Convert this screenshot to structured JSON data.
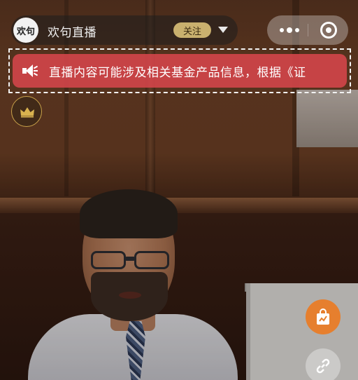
{
  "host": {
    "avatar_text": "欢句",
    "name": "欢句直播",
    "follow_label": "关注"
  },
  "notice": {
    "text": "直播内容可能涉及相关基金产品信息，根据《证"
  },
  "icons": {
    "dropdown": "chevron-down-icon",
    "more": "more-icon",
    "close": "close-mini-icon",
    "speaker": "speaker-icon",
    "crown": "crown-icon",
    "shop": "bag-icon",
    "link": "link-icon"
  },
  "colors": {
    "follow_bg": "#c9b06e",
    "notice_bg": "#d6464b",
    "shop_bg": "#e67f2e",
    "crown": "#c9a24a"
  }
}
